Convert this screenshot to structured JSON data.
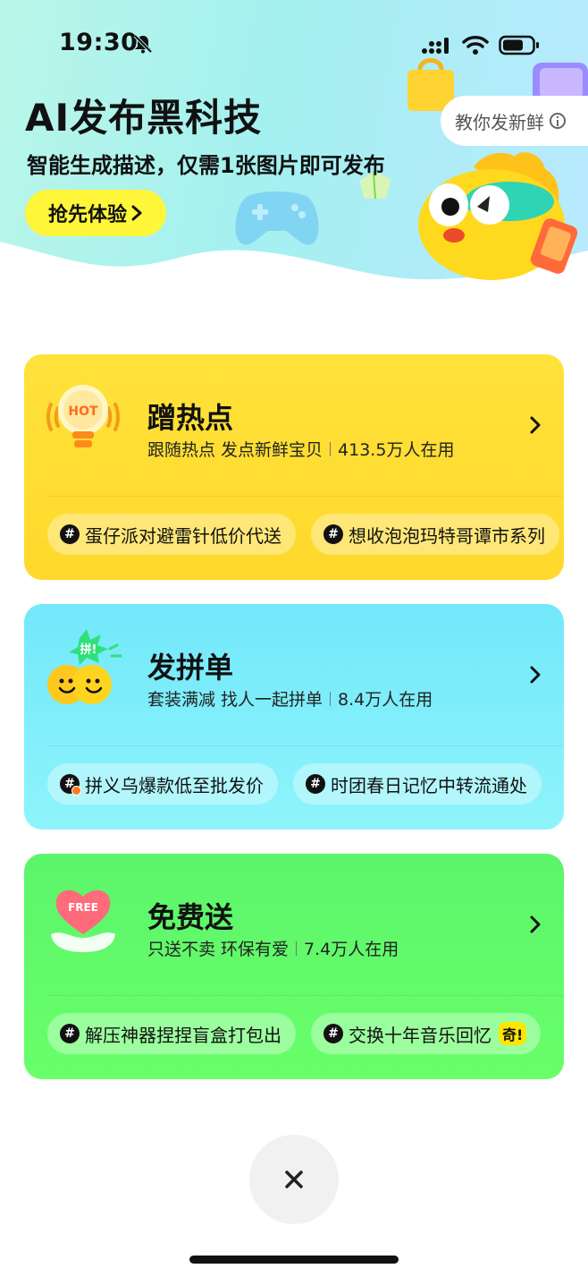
{
  "status_bar": {
    "time": "19:30"
  },
  "hero": {
    "title": "AI发布黑科技",
    "subtitle": "智能生成描述，仅需1张图片即可发布",
    "cta_label": "抢先体验",
    "teach_label": "教你发新鲜"
  },
  "cards": [
    {
      "title": "蹭热点",
      "desc": "跟随热点 发点新鲜宝贝",
      "users": "413.5万人在用",
      "icon_label": "HOT",
      "tags": [
        "蛋仔派对避雷针低价代送",
        "想收泡泡玛特哥谭市系列"
      ]
    },
    {
      "title": "发拼单",
      "desc": "套装满减 找人一起拼单",
      "users": "8.4万人在用",
      "icon_label": "拼!",
      "tags": [
        "拼义乌爆款低至批发价",
        "时团春日记忆中转流通处"
      ]
    },
    {
      "title": "免费送",
      "desc": "只送不卖 环保有爱",
      "users": "7.4万人在用",
      "icon_label": "FREE",
      "tags": [
        "解压神器捏捏盲盒打包出",
        "交换十年音乐回忆"
      ],
      "badge": "奇!"
    }
  ],
  "colors": {
    "yellow_card": "#ffdd32",
    "cyan_card": "#7eeefb",
    "green_card": "#62fa6a",
    "cta": "#fff63a"
  }
}
